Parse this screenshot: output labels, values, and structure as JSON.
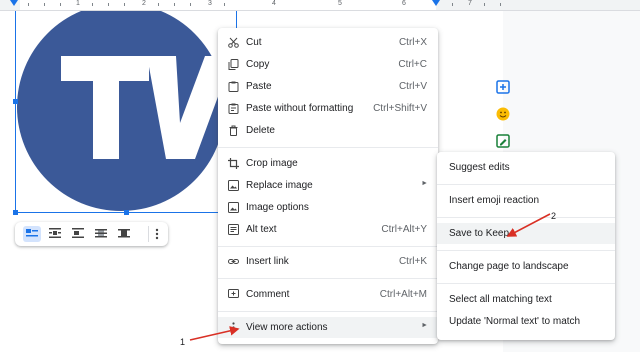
{
  "ruler": {
    "numbers": [
      "1",
      "2",
      "3",
      "4",
      "5",
      "6",
      "7"
    ]
  },
  "context_menu": {
    "items": [
      {
        "label": "Cut",
        "shortcut": "Ctrl+X",
        "icon": "scissors-icon"
      },
      {
        "label": "Copy",
        "shortcut": "Ctrl+C",
        "icon": "copy-icon"
      },
      {
        "label": "Paste",
        "shortcut": "Ctrl+V",
        "icon": "clipboard-icon"
      },
      {
        "label": "Paste without formatting",
        "shortcut": "Ctrl+Shift+V",
        "icon": "clipboard-plain-icon"
      },
      {
        "label": "Delete",
        "shortcut": "",
        "icon": "trash-icon"
      },
      {
        "label": "Crop image",
        "shortcut": "",
        "icon": "crop-icon"
      },
      {
        "label": "Replace image",
        "shortcut": "",
        "icon": "image-icon"
      },
      {
        "label": "Image options",
        "shortcut": "",
        "icon": "image-options-icon"
      },
      {
        "label": "Alt text",
        "shortcut": "Ctrl+Alt+Y",
        "icon": "alt-text-icon"
      },
      {
        "label": "Insert link",
        "shortcut": "Ctrl+K",
        "icon": "link-icon"
      },
      {
        "label": "Comment",
        "shortcut": "Ctrl+Alt+M",
        "icon": "comment-add-icon"
      },
      {
        "label": "View more actions",
        "shortcut": "",
        "icon": "more-vert-icon"
      }
    ]
  },
  "submenu": {
    "items": [
      {
        "label": "Suggest edits"
      },
      {
        "label": "Insert emoji reaction"
      },
      {
        "label": "Save to Keep"
      },
      {
        "label": "Change page to landscape"
      },
      {
        "label": "Select all matching text"
      },
      {
        "label": "Update 'Normal text' to match"
      }
    ]
  },
  "annotations": {
    "step1": "1",
    "step2": "2"
  },
  "colors": {
    "accent": "#1a73e8",
    "logo_blue": "#3b5998",
    "annotation_red": "#d93025"
  },
  "image": {
    "logo_text": "TV"
  }
}
